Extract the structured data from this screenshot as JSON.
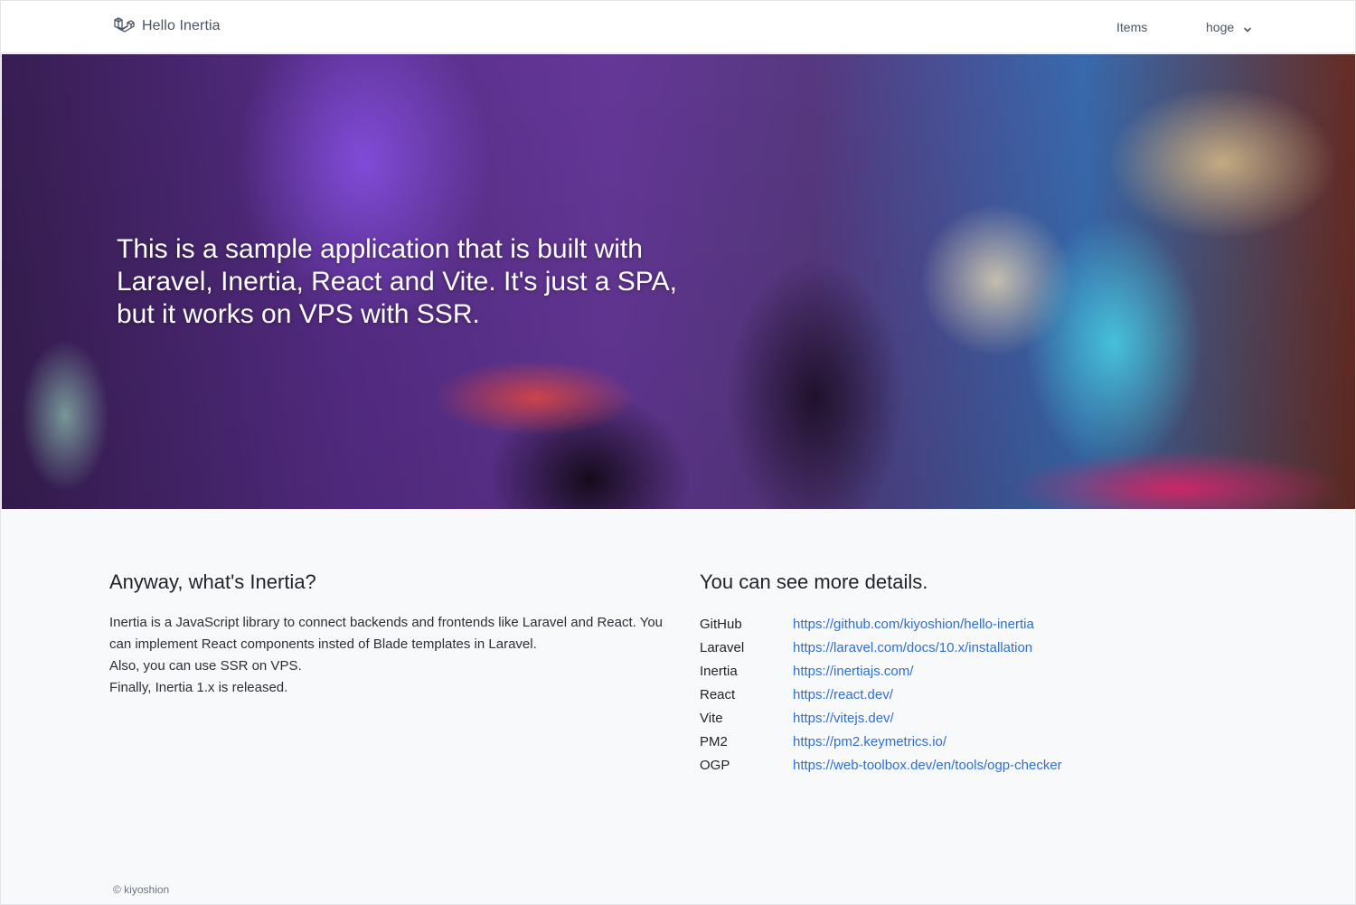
{
  "header": {
    "brand": "Hello Inertia",
    "nav_items": "Items",
    "user_name": "hoge"
  },
  "hero": {
    "text": "This is a sample application that is built with Laravel, Inertia, React and Vite. It's just a SPA, but it works on VPS with SSR."
  },
  "about": {
    "title": "Anyway, what's Inertia?",
    "lines": [
      "Inertia is a JavaScript library to connect backends and frontends like Laravel and React. You can implement React components insted of Blade templates in Laravel.",
      "Also, you can use SSR on VPS.",
      "Finally, Inertia 1.x is released."
    ]
  },
  "details": {
    "title": "You can see more details.",
    "links": [
      {
        "label": "GitHub",
        "url": "https://github.com/kiyoshion/hello-inertia"
      },
      {
        "label": "Laravel",
        "url": "https://laravel.com/docs/10.x/installation"
      },
      {
        "label": "Inertia",
        "url": "https://inertiajs.com/"
      },
      {
        "label": "React",
        "url": "https://react.dev/"
      },
      {
        "label": "Vite",
        "url": "https://vitejs.dev/"
      },
      {
        "label": "PM2",
        "url": "https://pm2.keymetrics.io/"
      },
      {
        "label": "OGP",
        "url": "https://web-toolbox.dev/en/tools/ogp-checker"
      }
    ]
  },
  "footer": {
    "copyright": "© kiyoshion"
  },
  "colors": {
    "link": "#2f6fd0",
    "text": "#1f2328",
    "page_bg": "#f8f9fa"
  },
  "icons": {
    "brand": "laravel-logo-icon",
    "user_menu": "chevron-down-icon"
  }
}
